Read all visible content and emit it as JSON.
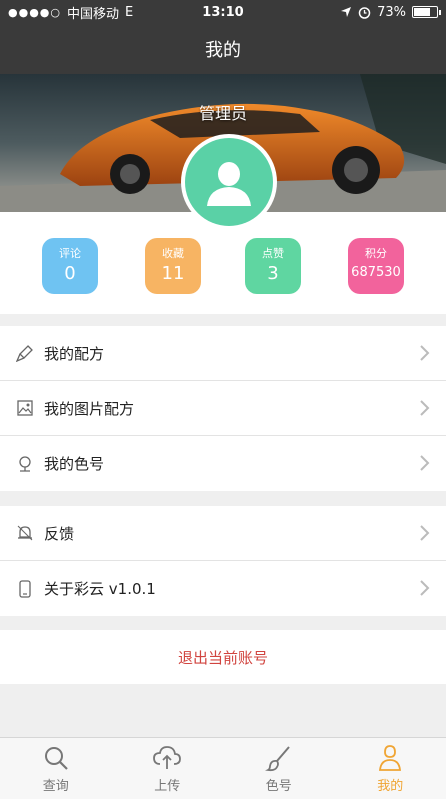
{
  "status_bar": {
    "signal_dots": "●●●●○",
    "carrier": "中国移动",
    "network": "E",
    "time": "13:10",
    "battery_percent": "73%",
    "battery_level": 0.73
  },
  "header": {
    "title": "我的"
  },
  "profile": {
    "username": "管理员"
  },
  "stats": [
    {
      "label": "评论",
      "value": "0",
      "color": "#6fc3f2"
    },
    {
      "label": "收藏",
      "value": "11",
      "color": "#f7b463"
    },
    {
      "label": "点赞",
      "value": "3",
      "color": "#5fd6a1"
    },
    {
      "label": "积分",
      "value": "687530",
      "color": "#f2639c"
    }
  ],
  "menu_group_1": [
    {
      "label": "我的配方",
      "icon": "brush-icon"
    },
    {
      "label": "我的图片配方",
      "icon": "image-icon"
    },
    {
      "label": "我的色号",
      "icon": "color-marker-icon"
    }
  ],
  "menu_group_2": [
    {
      "label": "反馈",
      "icon": "feedback-bell-icon"
    },
    {
      "label": "关于彩云 v1.0.1",
      "icon": "phone-icon"
    }
  ],
  "logout_label": "退出当前账号",
  "tabs": [
    {
      "label": "查询",
      "icon": "search-icon",
      "active": false
    },
    {
      "label": "上传",
      "icon": "cloud-upload-icon",
      "active": false
    },
    {
      "label": "色号",
      "icon": "paintbrush-icon",
      "active": false
    },
    {
      "label": "我的",
      "icon": "profile-icon",
      "active": true
    }
  ],
  "colors": {
    "bar": "#3a3a3a",
    "accent": "#f0a534",
    "logout": "#d1443f",
    "avatar": "#5ad1a6"
  }
}
